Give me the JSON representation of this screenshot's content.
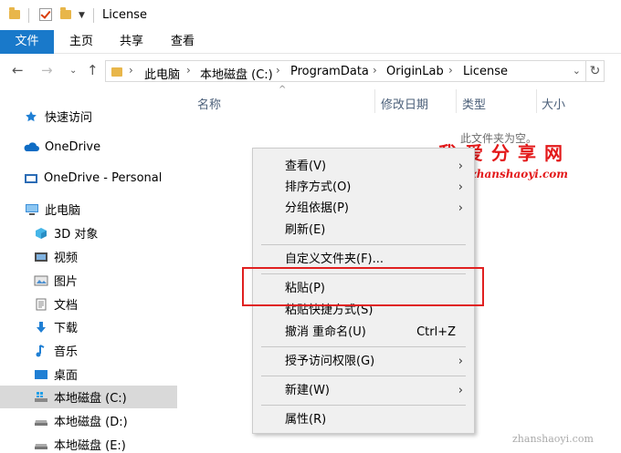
{
  "window": {
    "title": "License"
  },
  "ribbon": {
    "tabs": [
      "文件",
      "主页",
      "共享",
      "查看"
    ]
  },
  "address": {
    "crumbs": [
      "此电脑",
      "本地磁盘 (C:)",
      "ProgramData",
      "OriginLab",
      "License"
    ]
  },
  "nav": {
    "items": [
      "快速访问",
      "OneDrive",
      "OneDrive - Personal",
      "此电脑",
      "3D 对象",
      "视频",
      "图片",
      "文档",
      "下载",
      "音乐",
      "桌面",
      "本地磁盘 (C:)",
      "本地磁盘 (D:)",
      "本地磁盘 (E:)"
    ],
    "selected": "本地磁盘 (C:)"
  },
  "columns": [
    "名称",
    "修改日期",
    "类型",
    "大小"
  ],
  "empty_message": "此文件夹为空。",
  "context_menu": {
    "items": [
      {
        "label": "查看(V)",
        "submenu": true
      },
      {
        "label": "排序方式(O)",
        "submenu": true
      },
      {
        "label": "分组依据(P)",
        "submenu": true
      },
      {
        "label": "刷新(E)"
      },
      {
        "label": "自定义文件夹(F)..."
      },
      {
        "label": "粘贴(P)"
      },
      {
        "label": "粘贴快捷方式(S)"
      },
      {
        "label": "撤消 重命名(U)",
        "shortcut": "Ctrl+Z"
      },
      {
        "label": "授予访问权限(G)",
        "submenu": true
      },
      {
        "label": "新建(W)",
        "submenu": true
      },
      {
        "label": "属性(R)"
      }
    ]
  },
  "watermark": {
    "title": "我爱分享网",
    "url": "www.zhanshaoyi.com",
    "corner": "zhanshaoyi.com"
  },
  "colors": {
    "file_tab": "#1979ca",
    "highlight": "#e02020",
    "watermark": "#e3191a"
  }
}
